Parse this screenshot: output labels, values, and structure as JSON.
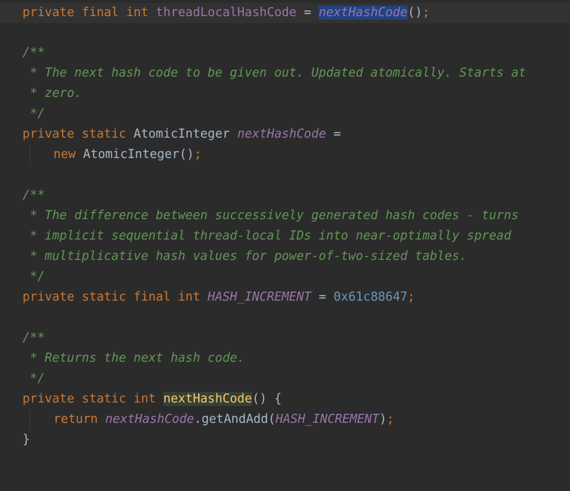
{
  "editor": {
    "lines": {
      "l1": {
        "kw": "private final int ",
        "field": "threadLocalHashCode",
        "eq": " = ",
        "call": "nextHashCode",
        "tail_paren": "()",
        "semi": ";"
      },
      "l3": {
        "text": "/**"
      },
      "l4": {
        "text": " * The next hash code to be given out. Updated atomically. Starts at"
      },
      "l5": {
        "text": " * zero."
      },
      "l6": {
        "text": " */"
      },
      "l7": {
        "kw": "private static ",
        "type": "AtomicInteger ",
        "field": "nextHashCode",
        "eq": " ="
      },
      "l8": {
        "kw": "new ",
        "ctor": "AtomicInteger()",
        "semi": ";"
      },
      "l10": {
        "text": "/**"
      },
      "l11": {
        "text": " * The difference between successively generated hash codes - turns"
      },
      "l12": {
        "text": " * implicit sequential thread-local IDs into near-optimally spread"
      },
      "l13": {
        "text": " * multiplicative hash values for power-of-two-sized tables."
      },
      "l14": {
        "text": " */"
      },
      "l15": {
        "kw": "private static final int ",
        "field": "HASH_INCREMENT",
        "eq": " = ",
        "num": "0x61c88647",
        "semi": ";"
      },
      "l17": {
        "text": "/**"
      },
      "l18": {
        "text": " * Returns the next hash code."
      },
      "l19": {
        "text": " */"
      },
      "l20": {
        "kw": "private static int ",
        "method": "nextHashCode",
        "tail": "() {"
      },
      "l21": {
        "kw": "return ",
        "field": "nextHashCode",
        "call": ".getAndAdd(",
        "arg": "HASH_INCREMENT",
        "close": ")",
        "semi": ";"
      },
      "l22": {
        "text": "}"
      }
    }
  }
}
